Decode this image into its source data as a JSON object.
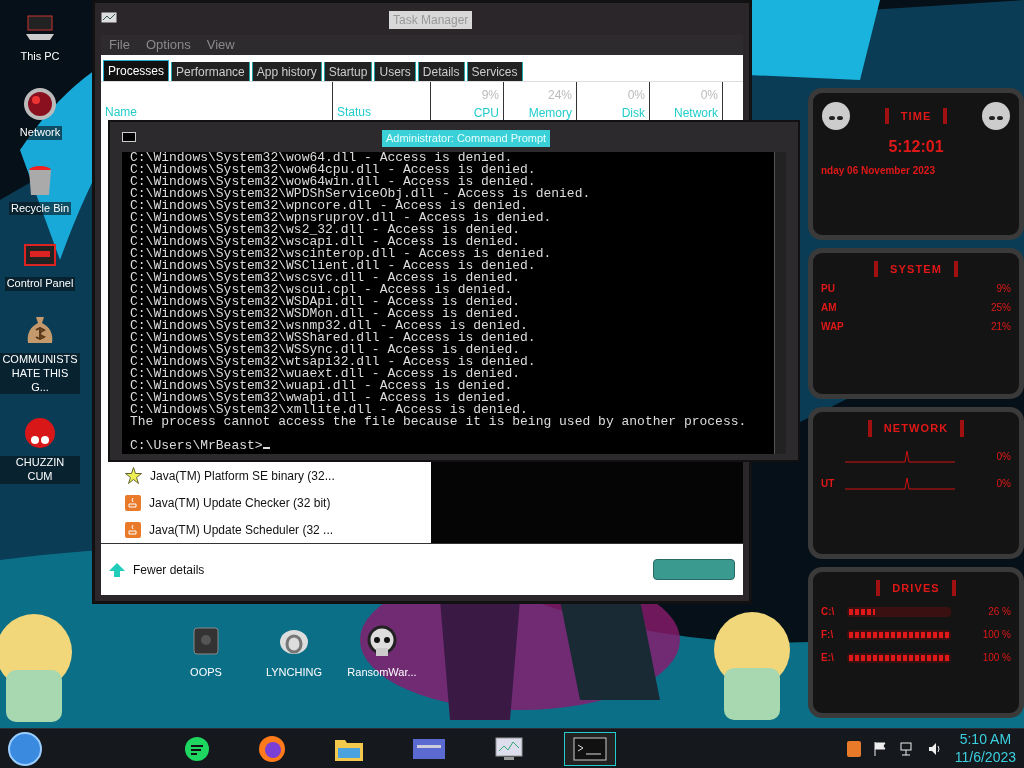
{
  "desktop_icons": [
    {
      "label": "This PC",
      "kind": "pc"
    },
    {
      "label": "Network",
      "kind": "globe"
    },
    {
      "label": "Recycle Bin",
      "kind": "bin"
    },
    {
      "label": "Control Panel",
      "kind": "panel"
    },
    {
      "label": "COMMUNISTS HATE THIS G...",
      "kind": "bag"
    },
    {
      "label": "CHUZZIN CUM",
      "kind": "fuzz"
    }
  ],
  "bottom_icons": [
    {
      "label": "OOPS",
      "kind": "monitor"
    },
    {
      "label": "LYNCHING",
      "kind": "knot"
    },
    {
      "label": "RansomWar...",
      "kind": "skull"
    }
  ],
  "task_manager": {
    "title": "Task Manager",
    "menu": [
      "File",
      "Options",
      "View"
    ],
    "tabs": [
      {
        "label": "Processes",
        "selected": true
      },
      {
        "label": "Performance",
        "selected": false
      },
      {
        "label": "App history",
        "selected": false
      },
      {
        "label": "Startup",
        "selected": false
      },
      {
        "label": "Users",
        "selected": false
      },
      {
        "label": "Details",
        "selected": false
      },
      {
        "label": "Services",
        "selected": false
      }
    ],
    "columns": [
      {
        "label": "Name"
      },
      {
        "label": "Status"
      },
      {
        "usage": "9%",
        "label": "CPU"
      },
      {
        "usage": "24%",
        "label": "Memory"
      },
      {
        "usage": "0%",
        "label": "Disk"
      },
      {
        "usage": "0%",
        "label": "Network"
      }
    ],
    "rows": [
      {
        "name": "Java(TM) Platform SE binary (32...",
        "kind": "star"
      },
      {
        "name": "Java(TM) Update Checker (32 bit)",
        "kind": "java"
      },
      {
        "name": "Java(TM) Update Scheduler (32 ...",
        "kind": "java"
      }
    ],
    "footer": {
      "link": "Fewer details"
    }
  },
  "command_prompt": {
    "title": "Administrator: Command Prompt",
    "lines": [
      "C:\\Windows\\System32\\wow64.dll - Access is denied.",
      "C:\\Windows\\System32\\wow64cpu.dll - Access is denied.",
      "C:\\Windows\\System32\\wow64win.dll - Access is denied.",
      "C:\\Windows\\System32\\WPDShServiceObj.dll - Access is denied.",
      "C:\\Windows\\System32\\wpncore.dll - Access is denied.",
      "C:\\Windows\\System32\\wpnsruprov.dll - Access is denied.",
      "C:\\Windows\\System32\\ws2_32.dll - Access is denied.",
      "C:\\Windows\\System32\\wscapi.dll - Access is denied.",
      "C:\\Windows\\System32\\wscinterop.dll - Access is denied.",
      "C:\\Windows\\System32\\WSClient.dll - Access is denied.",
      "C:\\Windows\\System32\\wscsvc.dll - Access is denied.",
      "C:\\Windows\\System32\\wscui.cpl - Access is denied.",
      "C:\\Windows\\System32\\WSDApi.dll - Access is denied.",
      "C:\\Windows\\System32\\WSDMon.dll - Access is denied.",
      "C:\\Windows\\System32\\wsnmp32.dll - Access is denied.",
      "C:\\Windows\\System32\\WSShared.dll - Access is denied.",
      "C:\\Windows\\System32\\WSSync.dll - Access is denied.",
      "C:\\Windows\\System32\\wtsapi32.dll - Access is denied.",
      "C:\\Windows\\System32\\wuaext.dll - Access is denied.",
      "C:\\Windows\\System32\\wuapi.dll - Access is denied.",
      "C:\\Windows\\System32\\wwapi.dll - Access is denied.",
      "C:\\Windows\\System32\\xmllite.dll - Access is denied.",
      "The process cannot access the file because it is being used by another process.",
      "C:\\Users\\MrBeast>"
    ]
  },
  "gadgets": {
    "time": {
      "title": "TIME",
      "clock": "5:12:01",
      "date": "nday 06 November 2023"
    },
    "system": {
      "title": "SYSTEM",
      "rows": [
        {
          "label": "PU",
          "value": "9%"
        },
        {
          "label": "AM",
          "value": "25%"
        },
        {
          "label": "WAP",
          "value": "21%"
        }
      ]
    },
    "network": {
      "title": "NETWORK",
      "rows": [
        {
          "value": "0%"
        },
        {
          "label": "UT",
          "value": "0%"
        }
      ]
    },
    "drives": {
      "title": "DRIVES",
      "rows": [
        {
          "label": "C:\\",
          "level": 0.26,
          "value": "26 %"
        },
        {
          "label": "F:\\",
          "level": 1,
          "value": "100 %"
        },
        {
          "label": "E:\\",
          "level": 1,
          "value": "100 %"
        }
      ]
    }
  },
  "taskbar": {
    "apps": [
      {
        "kind": "chat",
        "active": false
      },
      {
        "kind": "browser",
        "active": false
      },
      {
        "kind": "folder",
        "active": false
      },
      {
        "kind": "card",
        "active": false
      },
      {
        "kind": "monitor",
        "active": false
      },
      {
        "kind": "console",
        "active": true
      }
    ],
    "time": "5:10 AM",
    "date": "11/6/2023"
  }
}
